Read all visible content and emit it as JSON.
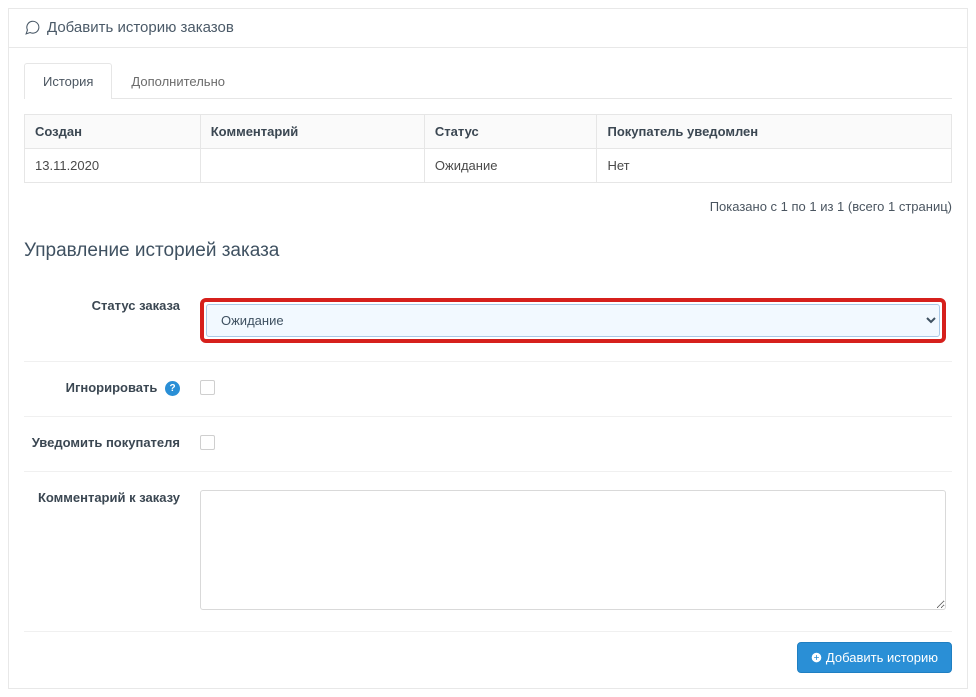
{
  "panel": {
    "title": "Добавить историю заказов"
  },
  "tabs": {
    "history": "История",
    "additional": "Дополнительно"
  },
  "table": {
    "headers": {
      "created": "Создан",
      "comment": "Комментарий",
      "status": "Статус",
      "notified": "Покупатель уведомлен"
    },
    "row": {
      "created": "13.11.2020",
      "comment": "",
      "status": "Ожидание",
      "notified": "Нет"
    }
  },
  "pagination_info": "Показано с 1 по 1 из 1 (всего 1 страниц)",
  "section_title": "Управление историей заказа",
  "form": {
    "status_label": "Статус заказа",
    "status_value": "Ожидание",
    "ignore_label": "Игнорировать",
    "notify_label": "Уведомить покупателя",
    "comment_label": "Комментарий к заказу",
    "help_symbol": "?"
  },
  "button": {
    "add_history": "Добавить историю"
  }
}
